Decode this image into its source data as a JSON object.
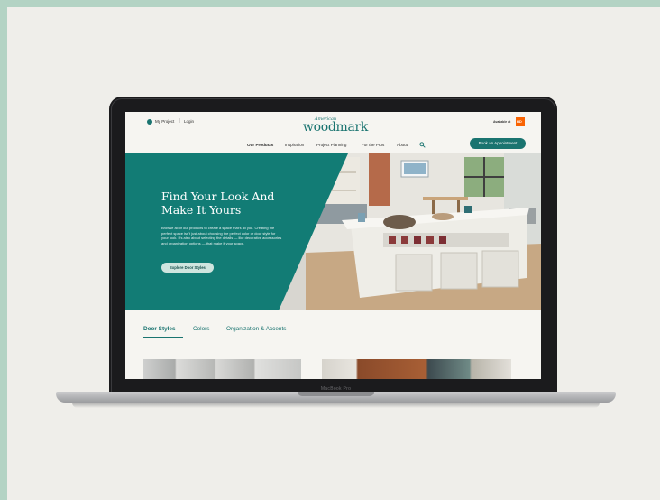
{
  "device": {
    "brand_label": "MacBook Pro"
  },
  "site": {
    "topbar": {
      "my_project": "My Project",
      "separator": "|",
      "login": "Login",
      "logo_small": "American",
      "logo_big": "woodmark",
      "available_at": "Available at",
      "retailer_logo_text": "HD"
    },
    "nav": {
      "items": [
        "Our Products",
        "Inspiration",
        "Project Planning",
        "For the Pros",
        "About"
      ],
      "active_index": 0,
      "cta": "Book an Appointment"
    },
    "hero": {
      "title_line1": "Find Your Look And",
      "title_line2": "Make It Yours",
      "body": "Browse all of our products to create a space that's all you. Creating the perfect space isn't just about choosing the perfect color or door style for your look. It's also about selecting the details — like decorative accessories and organization options — that make it your space.",
      "button": "Explore Door Styles"
    },
    "tabs": {
      "items": [
        "Door Styles",
        "Colors",
        "Organization & Accents"
      ],
      "active_index": 0
    }
  },
  "colors": {
    "brand_teal": "#1a7470",
    "page_bg": "#f6f5f1",
    "outer_bg": "#b3d3c4",
    "panel_bg": "#efeeea",
    "retailer_orange": "#f96302"
  },
  "icons": [
    "location-dot-icon",
    "search-icon",
    "home-depot-logo"
  ]
}
